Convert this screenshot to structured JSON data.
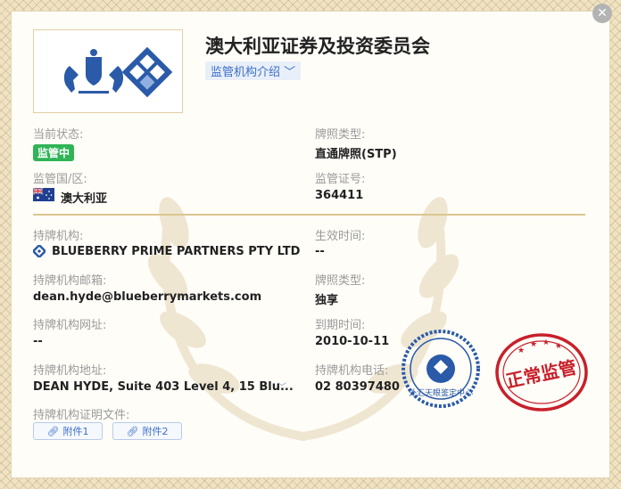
{
  "header": {
    "title": "澳大利亚证券及投资委员会",
    "intro_label": "监管机构介绍"
  },
  "fields": {
    "status_label": "当前状态:",
    "status_value": "监管中",
    "license_type_label": "牌照类型:",
    "license_type_value": "直通牌照(STP)",
    "region_label": "监管国/区:",
    "region_value": "澳大利亚",
    "license_no_label": "监管证号:",
    "license_no_value": "364411",
    "holder_label": "持牌机构:",
    "holder_value": "BLUEBERRY PRIME PARTNERS PTY LTD",
    "effective_label": "生效时间:",
    "effective_value": "--",
    "email_label": "持牌机构邮箱:",
    "email_value": "dean.hyde@blueberrymarkets.com",
    "license_type2_label": "牌照类型:",
    "license_type2_value": "独享",
    "website_label": "持牌机构网址:",
    "website_value": "--",
    "expiry_label": "到期时间:",
    "expiry_value": "2010-10-11",
    "address_label": "持牌机构地址:",
    "address_value": "DEAN HYDE, Suite 403 Level 4, 15 Blu...",
    "phone_label": "持牌机构电话:",
    "phone_value": "02 80397480",
    "docs_label": "持牌机构证明文件:"
  },
  "attachments": [
    "附件1",
    "附件2"
  ],
  "stamps": {
    "blue_text": "外汇天眼鉴定中心",
    "red_text": "正常监管"
  },
  "colors": {
    "accent_blue": "#3b6fc9",
    "status_green": "#2fb456",
    "stamp_red": "#c8202a",
    "stamp_blue": "#2a5aa8",
    "divider_gold": "#dcc690"
  }
}
